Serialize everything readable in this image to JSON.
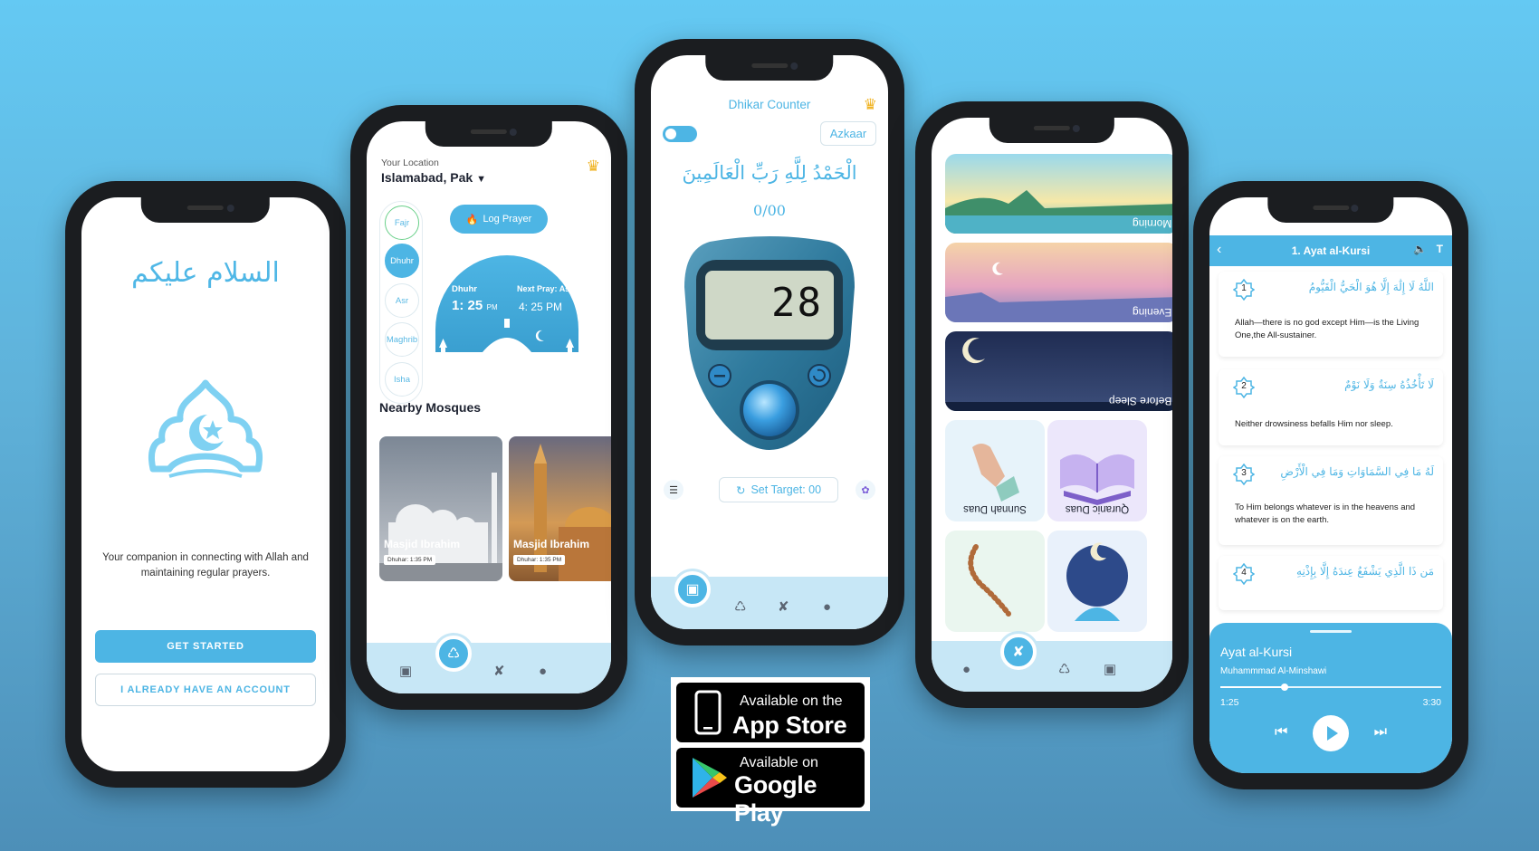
{
  "colors": {
    "accent": "#4db5e4",
    "nav_bg": "#c7e7f6",
    "crown": "#f0b323"
  },
  "welcome": {
    "greeting": "السلام عليكم",
    "tagline": "Your companion in connecting with Allah and maintaining regular prayers.",
    "get_started": "GET STARTED",
    "have_account": "I ALREADY HAVE AN ACCOUNT"
  },
  "home": {
    "location_label": "Your Location",
    "location_city": "Islamabad, Pak",
    "prayers": [
      "Fajr",
      "Dhuhr",
      "Asr",
      "Maghrib",
      "Isha"
    ],
    "log_prayer": "Log Prayer",
    "current_prayer": "Dhuhr",
    "current_time": "1: 25",
    "current_ampm": "PM",
    "next_label": "Next Pray: Asr",
    "next_time": "4: 25 PM",
    "nearby_title": "Nearby Mosques",
    "mosques": [
      {
        "name": "Masjid Ibrahim",
        "time": "Dhuhar: 1:35 PM"
      },
      {
        "name": "Masjid Ibrahim",
        "time": "Dhuhar: 1:35 PM"
      }
    ]
  },
  "dhikr": {
    "title": "Dhikar Counter",
    "azkaar": "Azkaar",
    "verse": "الْحَمْدُ لِلَّهِ رَبِّ الْعَالَمِينَ",
    "progress": "0/00",
    "display": "28",
    "set_target": "Set Target: 00"
  },
  "duas": {
    "banners": [
      "Morning",
      "Evening",
      "Before Sleep"
    ],
    "tiles": [
      "Sunnah Duas",
      "Quranic Duas"
    ]
  },
  "quran": {
    "header_title": "1. Ayat al-Kursi",
    "verses": [
      {
        "num": "1",
        "arabic": "اللَّهُ لَا إِلَٰهَ إِلَّا هُوَ الْحَيُّ الْقَيُّومُ",
        "translation": "Allah—there is no god except Him—is the Living One,the All-sustainer."
      },
      {
        "num": "2",
        "arabic": "لَا تَأْخُذُهُ سِنَةٌ وَلَا نَوْمٌ",
        "translation": "Neither drowsiness befalls Him nor sleep."
      },
      {
        "num": "3",
        "arabic": "لَهُ مَا فِي السَّمَاوَاتِ وَمَا فِي الْأَرْضِ",
        "translation": "To Him belongs whatever is in the heavens and whatever is on the earth."
      },
      {
        "num": "4",
        "arabic": "مَن ذَا الَّذِي يَشْفَعُ عِندَهُ إِلَّا بِإِذْنِهِ",
        "translation": ""
      }
    ],
    "player": {
      "title": "Ayat al-Kursi",
      "reciter": "Muhammmad Al-Minshawi",
      "elapsed": "1:25",
      "total": "3:30",
      "progress": 0.29
    }
  },
  "stores": {
    "apple_small": "Available on the",
    "apple_big": "App Store",
    "google_small": "Available on",
    "google_big": "Google Play"
  }
}
